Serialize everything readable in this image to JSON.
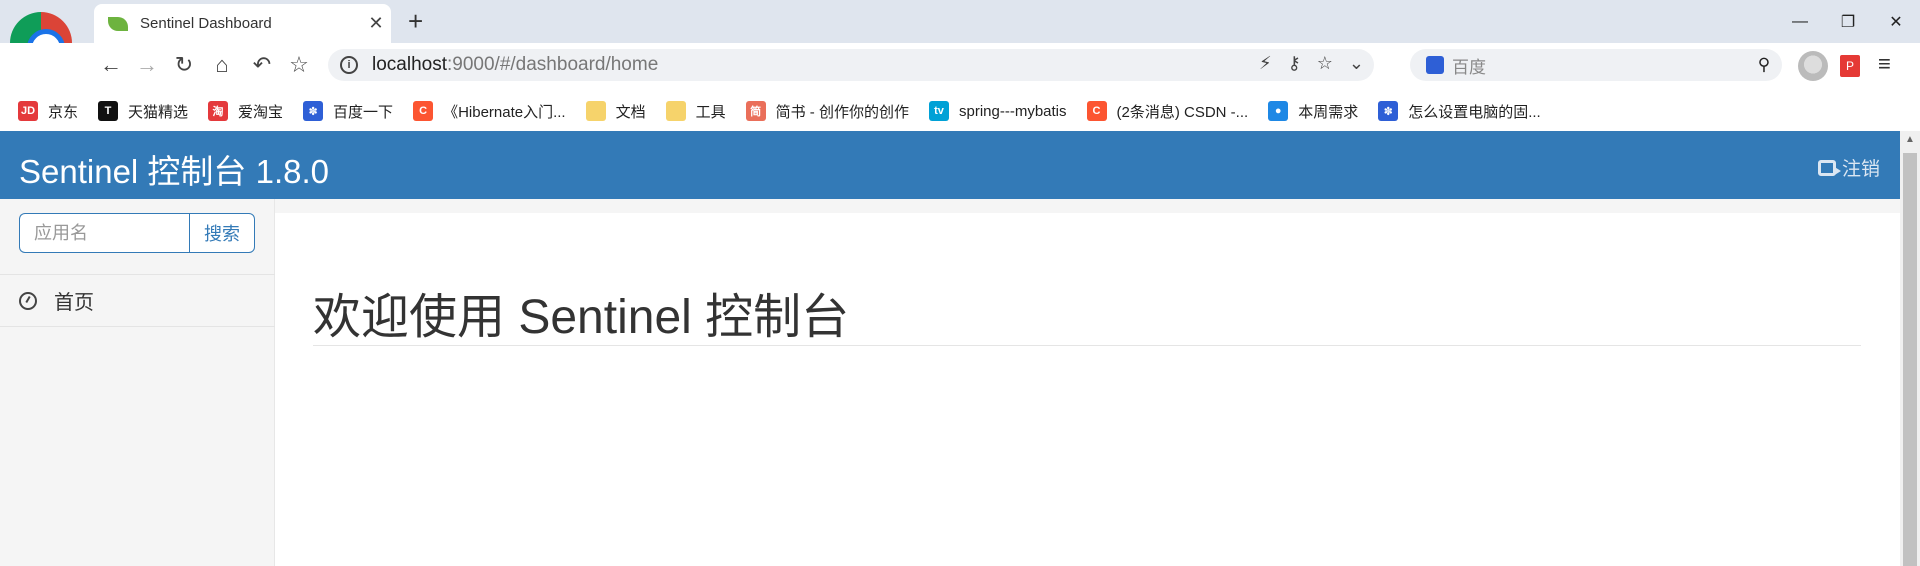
{
  "browser": {
    "tab_title": "Sentinel Dashboard",
    "tab_close": "✕",
    "new_tab": "+",
    "url_host": "localhost",
    "url_path": ":9000/#/dashboard/home",
    "search_placeholder": "百度",
    "window_controls": {
      "minimize": "—",
      "restore": "❐",
      "close": "✕"
    }
  },
  "bookmarks": [
    {
      "label": "京东",
      "icon_text": "JD",
      "color": "#e4393c"
    },
    {
      "label": "天猫精选",
      "icon_text": "T",
      "color": "#111111"
    },
    {
      "label": "爱淘宝",
      "icon_text": "淘",
      "color": "#e4393c"
    },
    {
      "label": "百度一下",
      "icon_text": "✽",
      "color": "#2e5fd6"
    },
    {
      "label": "《Hibernate入门...",
      "icon_text": "C",
      "color": "#fc5531"
    },
    {
      "label": "文档",
      "icon_text": "",
      "color": "#f6d36b"
    },
    {
      "label": "工具",
      "icon_text": "",
      "color": "#f6d36b"
    },
    {
      "label": "简书 - 创作你的创作",
      "icon_text": "简",
      "color": "#ea6f5a"
    },
    {
      "label": "spring---mybatis",
      "icon_text": "tv",
      "color": "#00a1d6"
    },
    {
      "label": "(2条消息) CSDN -...",
      "icon_text": "C",
      "color": "#fc5531"
    },
    {
      "label": "本周需求",
      "icon_text": "●",
      "color": "#1e88e5"
    },
    {
      "label": "怎么设置电脑的固...",
      "icon_text": "✽",
      "color": "#2e5fd6"
    }
  ],
  "app": {
    "brand": "Sentinel 控制台 1.8.0",
    "logout": "注销",
    "search": {
      "placeholder": "应用名",
      "button": "搜索"
    },
    "sidebar_items": [
      {
        "label": "首页"
      }
    ],
    "welcome": "欢迎使用 Sentinel 控制台"
  },
  "colors": {
    "header": "#337ab7",
    "sidebar": "#f5f5f5"
  }
}
